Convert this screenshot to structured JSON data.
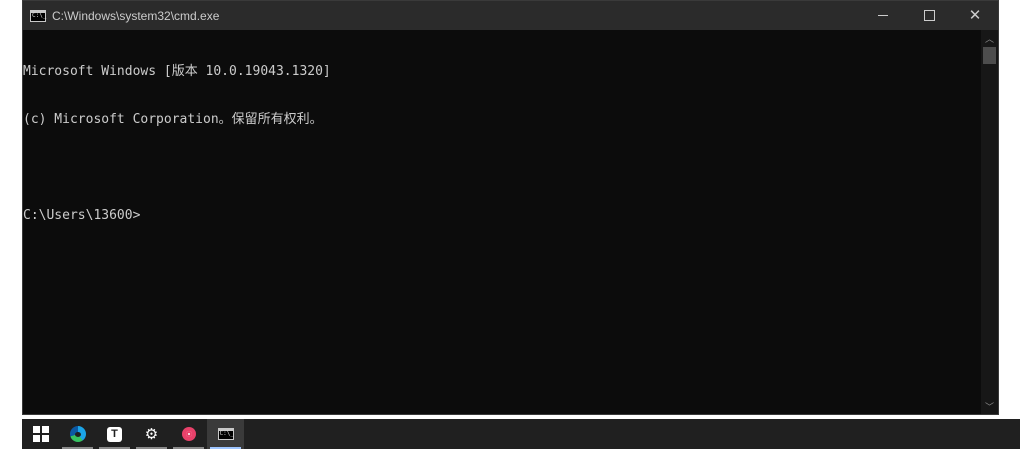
{
  "window": {
    "title": "C:\\Windows\\system32\\cmd.exe",
    "controls": {
      "minimize": "minimize",
      "maximize": "maximize",
      "close": "✕"
    }
  },
  "console": {
    "lines": [
      "Microsoft Windows [版本 10.0.19043.1320]",
      "(c) Microsoft Corporation。保留所有权利。",
      "",
      "C:\\Users\\13600>"
    ]
  },
  "scrollbar": {
    "up": "︿",
    "down": "﹀"
  },
  "taskbar": {
    "items": [
      {
        "name": "start",
        "icon": "windows-logo-icon"
      },
      {
        "name": "edge",
        "icon": "edge-browser-icon",
        "running": true
      },
      {
        "name": "typora",
        "icon": "typora-icon",
        "glyph": "T",
        "running": true
      },
      {
        "name": "settings",
        "icon": "gear-icon",
        "glyph": "⚙",
        "running": true
      },
      {
        "name": "screen-recorder",
        "icon": "record-icon",
        "running": true
      },
      {
        "name": "cmd",
        "icon": "cmd-icon",
        "running": true,
        "active": true
      }
    ]
  },
  "colors": {
    "console_bg": "#0c0c0c",
    "console_fg": "#cccccc",
    "titlebar_bg": "#2b2b2b",
    "taskbar_bg": "#202020"
  }
}
